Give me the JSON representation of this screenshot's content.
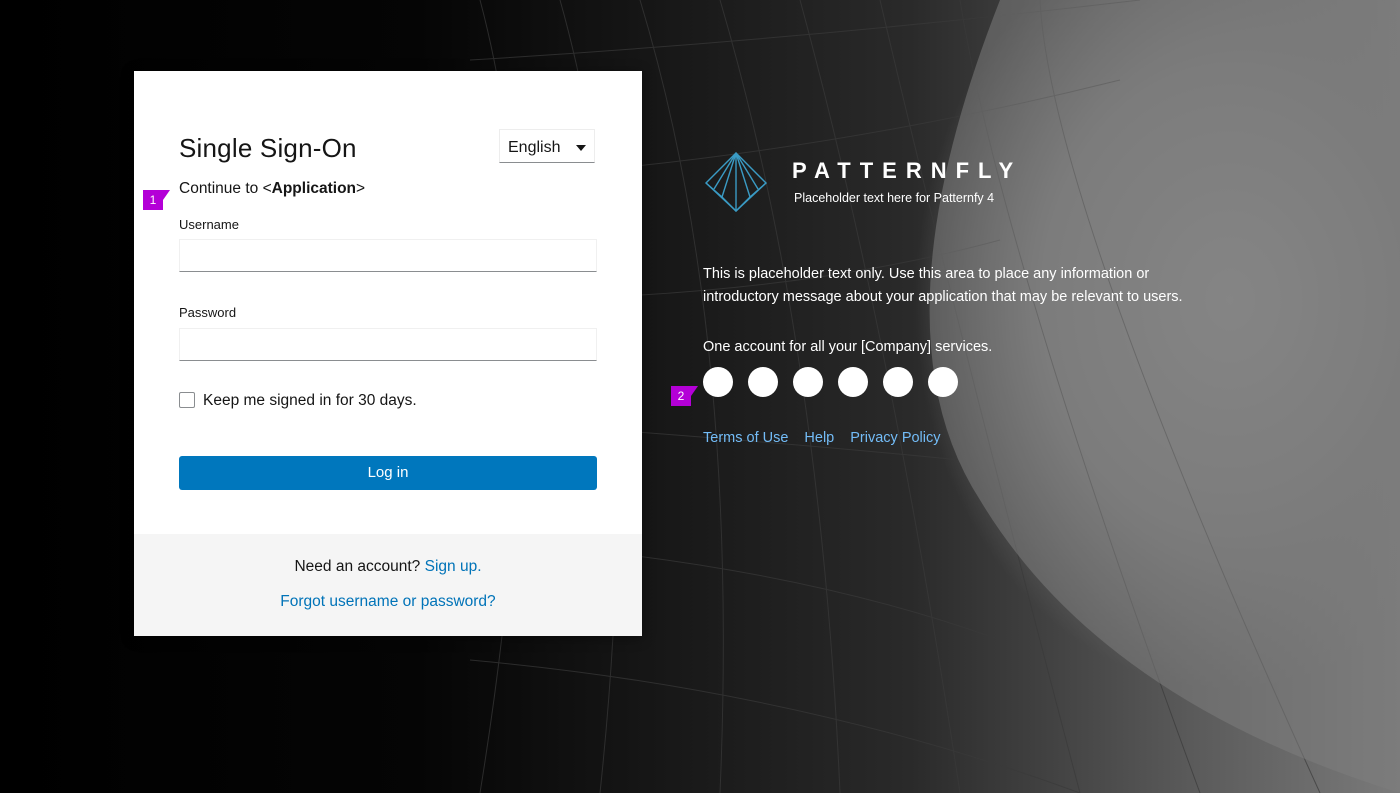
{
  "login": {
    "title": "Single Sign-On",
    "language": "English",
    "continue_prefix": "Continue to <",
    "continue_app": "Application",
    "continue_suffix": ">",
    "username_label": "Username",
    "username_value": "",
    "password_label": "Password",
    "password_value": "",
    "remember_label": "Keep me signed in for 30 days.",
    "remember_checked": false,
    "login_button": "Log in",
    "need_account": "Need an account?",
    "sign_up": "Sign up.",
    "forgot": "Forgot username or password?"
  },
  "annotations": {
    "marker_1": "1",
    "marker_2": "2"
  },
  "brand": {
    "name": "PATTERNFLY",
    "subtitle": "Placeholder text here for Patternfy 4",
    "intro": "This is placeholder text only. Use this area to place any information or introductory message about your application that may be relevant to users.",
    "one_account": "One account for all your [Company] services.",
    "social_icons": [
      "social-icon-1",
      "social-icon-2",
      "social-icon-3",
      "social-icon-4",
      "social-icon-5",
      "social-icon-6"
    ],
    "links": {
      "terms": "Terms of Use",
      "help": "Help",
      "privacy": "Privacy Policy"
    }
  },
  "colors": {
    "primary_button": "#0077bd",
    "link": "#0073b8",
    "footer_link": "#73bcf7",
    "annotation": "#b400d7"
  }
}
